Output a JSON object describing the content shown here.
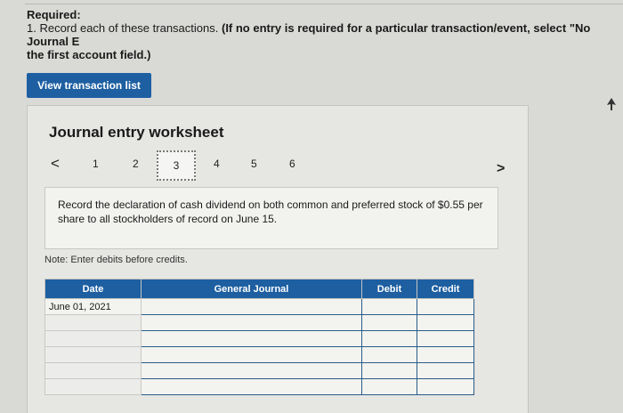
{
  "required": {
    "label": "Required:",
    "instruction": "1. Record each of these transactions.",
    "instruction_bold": "(If no entry is required for a particular transaction/event, select \"No Journal E",
    "instruction_bold_line2": "the first account field.)"
  },
  "view_transaction_button": "View transaction list",
  "worksheet": {
    "title": "Journal entry worksheet",
    "pages": [
      "1",
      "2",
      "3",
      "4",
      "5",
      "6"
    ],
    "active_page": "3",
    "prev_symbol": "<",
    "next_symbol": ">",
    "description": "Record the declaration of cash dividend on both common and preferred stock of $0.55 per share to all stockholders of record on June 15.",
    "note": "Note: Enter debits before credits.",
    "table": {
      "headers": {
        "date": "Date",
        "general_journal": "General Journal",
        "debit": "Debit",
        "credit": "Credit"
      },
      "rows": [
        {
          "date": "June 01, 2021"
        },
        {
          "date": ""
        },
        {
          "date": ""
        },
        {
          "date": ""
        },
        {
          "date": ""
        },
        {
          "date": ""
        }
      ]
    }
  }
}
